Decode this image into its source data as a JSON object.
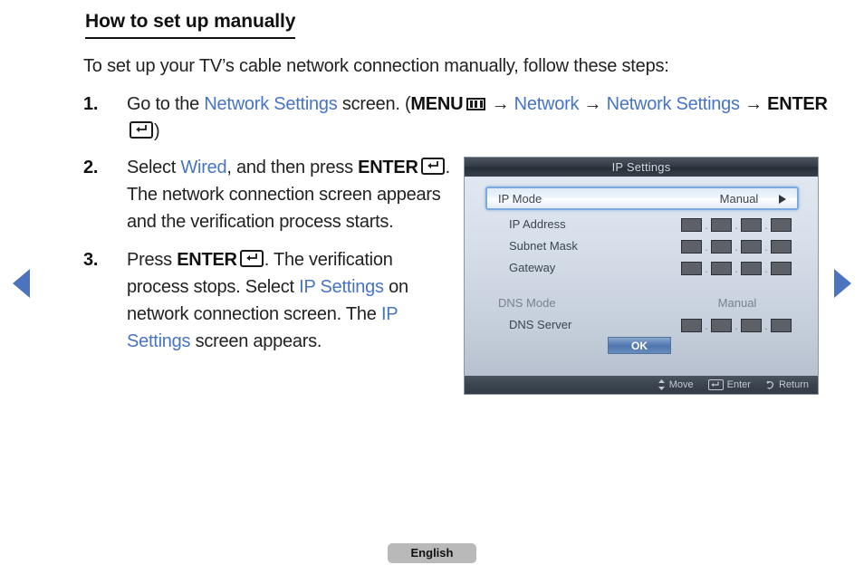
{
  "heading": "How to set up manually",
  "intro": "To set up your TV’s cable network connection manually, follow these steps:",
  "steps": [
    {
      "num": "1.",
      "t1": "Go to the ",
      "link1": "Network Settings",
      "t2": " screen. (",
      "bold1": "MENU",
      "t3": " → ",
      "link2": "Network",
      "t4": " → ",
      "link3": "Network Settings",
      "t5": " → ",
      "bold2": "ENTER",
      "t6": ")"
    },
    {
      "num": "2.",
      "t1": "Select ",
      "link1": "Wired",
      "t2": ", and then press ",
      "bold1": "ENTER",
      "t3": ". The network connection screen appears and the verification process starts."
    },
    {
      "num": "3.",
      "t1": "Press ",
      "bold1": "ENTER",
      "t2": ". The verification process stops. Select ",
      "link1": "IP Settings",
      "t3": " on network connection screen. The ",
      "link2": "IP Settings",
      "t4": " screen appears."
    }
  ],
  "nav": {
    "prev_icon": "triangle-left-icon",
    "next_icon": "triangle-right-icon",
    "arrow_color": "#4c74be"
  },
  "osd": {
    "title": "IP Settings",
    "focused_row": {
      "label": "IP Mode",
      "value": "Manual",
      "arrow_icon": "chevron-right-icon"
    },
    "rows": [
      {
        "label": "IP Address",
        "type": "quad",
        "dim": false
      },
      {
        "label": "Subnet Mask",
        "type": "quad",
        "dim": false
      },
      {
        "label": "Gateway",
        "type": "quad",
        "dim": false
      }
    ],
    "dns_mode": {
      "label": "DNS Mode",
      "value": "Manual"
    },
    "dns_server": {
      "label": "DNS Server",
      "type": "quad"
    },
    "separator": ".",
    "ok_button": "OK",
    "hints": [
      {
        "icon": "updown-arrow-icon",
        "label": "Move"
      },
      {
        "icon": "enter-key-icon",
        "label": "Enter"
      },
      {
        "icon": "return-arrow-icon",
        "label": "Return"
      }
    ]
  },
  "page_label": "English",
  "colors": {
    "link_blue": "#4774c4",
    "osd_focus_border": "#7ca9e0",
    "ok_blue": "#4f77ae"
  }
}
